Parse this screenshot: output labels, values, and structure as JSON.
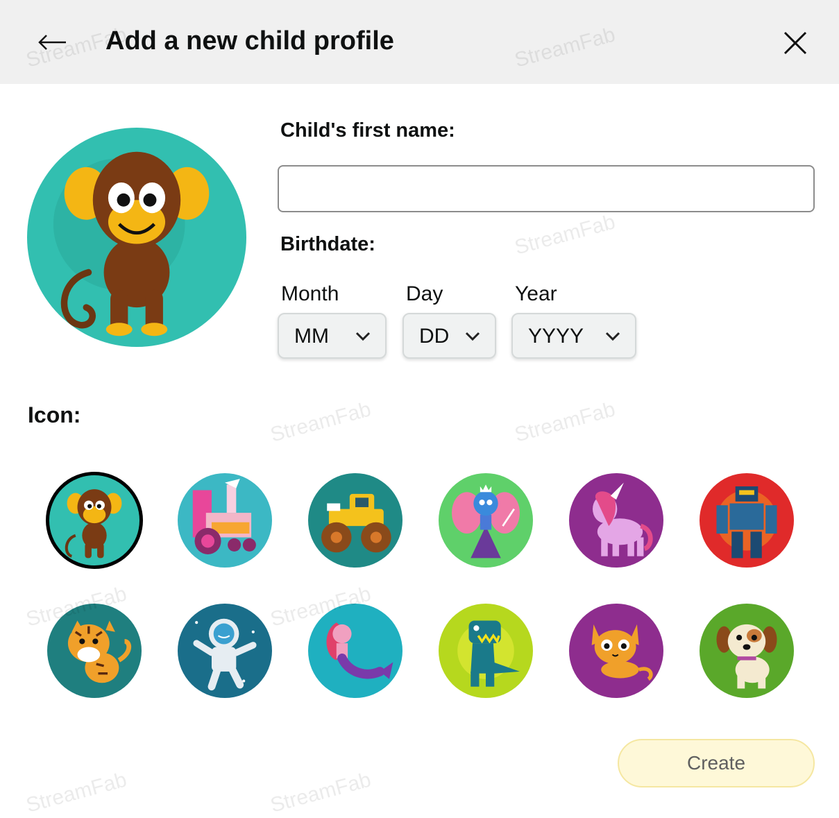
{
  "header": {
    "title": "Add a new child profile",
    "back_icon": "arrow-left-icon",
    "close_icon": "close-icon"
  },
  "form": {
    "name_label": "Child's first name:",
    "name_value": "",
    "name_placeholder": "",
    "birthdate_label": "Birthdate:",
    "month_label": "Month",
    "month_value": "MM",
    "day_label": "Day",
    "day_value": "DD",
    "year_label": "Year",
    "year_value": "YYYY"
  },
  "icons": {
    "label": "Icon:",
    "selected": "monkey",
    "items": [
      "monkey",
      "train",
      "monster-truck",
      "fairy",
      "unicorn",
      "robot",
      "tiger",
      "astronaut",
      "mermaid",
      "dinosaur",
      "cat",
      "puppy"
    ]
  },
  "actions": {
    "create_label": "Create"
  },
  "watermark": "StreamFab",
  "colors": {
    "header_bg": "#f0f0f0",
    "create_bg": "#fef8d8",
    "create_border": "#f5e7a1",
    "input_border": "#8c8c8c"
  }
}
